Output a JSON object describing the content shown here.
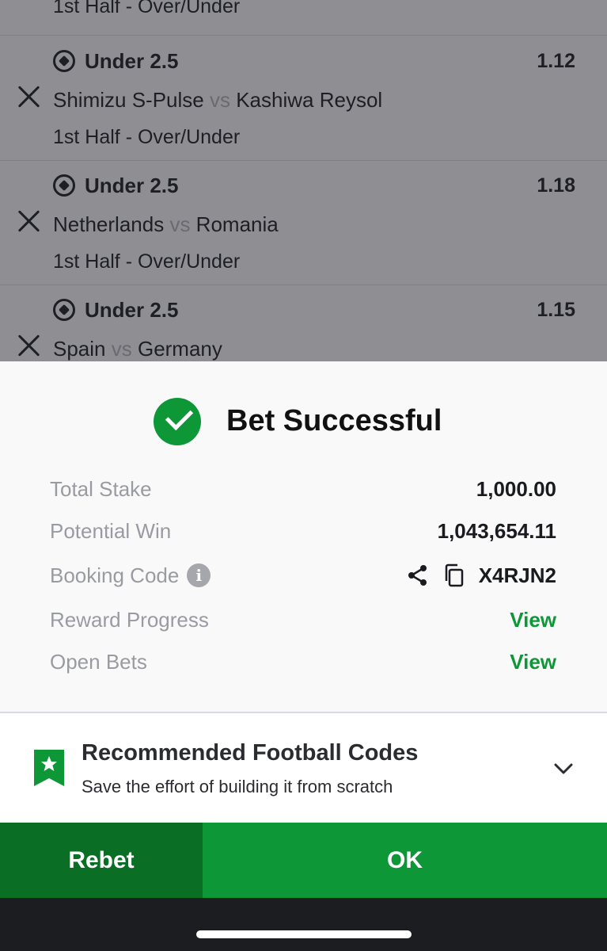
{
  "background": {
    "top_market": "1st Half - Over/Under",
    "bets": [
      {
        "pick": "Under 2.5",
        "odds": "1.12",
        "home": "Shimizu S-Pulse",
        "vs": "vs",
        "away": "Kashiwa Reysol",
        "market": "1st Half - Over/Under"
      },
      {
        "pick": "Under 2.5",
        "odds": "1.18",
        "home": "Netherlands",
        "vs": "vs",
        "away": "Romania",
        "market": "1st Half - Over/Under"
      },
      {
        "pick": "Under 2.5",
        "odds": "1.15",
        "home": "Spain",
        "vs": "vs",
        "away": "Germany",
        "market": ""
      }
    ]
  },
  "modal": {
    "title": "Bet Successful",
    "total_stake_label": "Total Stake",
    "total_stake_value": "1,000.00",
    "potential_win_label": "Potential Win",
    "potential_win_value": "1,043,654.11",
    "booking_code_label": "Booking Code",
    "booking_code_value": "X4RJN2",
    "reward_progress_label": "Reward Progress",
    "reward_progress_link": "View",
    "open_bets_label": "Open Bets",
    "open_bets_link": "View",
    "info_icon_glyph": "i"
  },
  "recommended": {
    "title": "Recommended Football Codes",
    "subtitle": "Save the effort of building it from scratch"
  },
  "actions": {
    "rebet_label": "Rebet",
    "ok_label": "OK"
  },
  "colors": {
    "brand_green": "#0d9737",
    "dark_green": "#0a6e25"
  }
}
